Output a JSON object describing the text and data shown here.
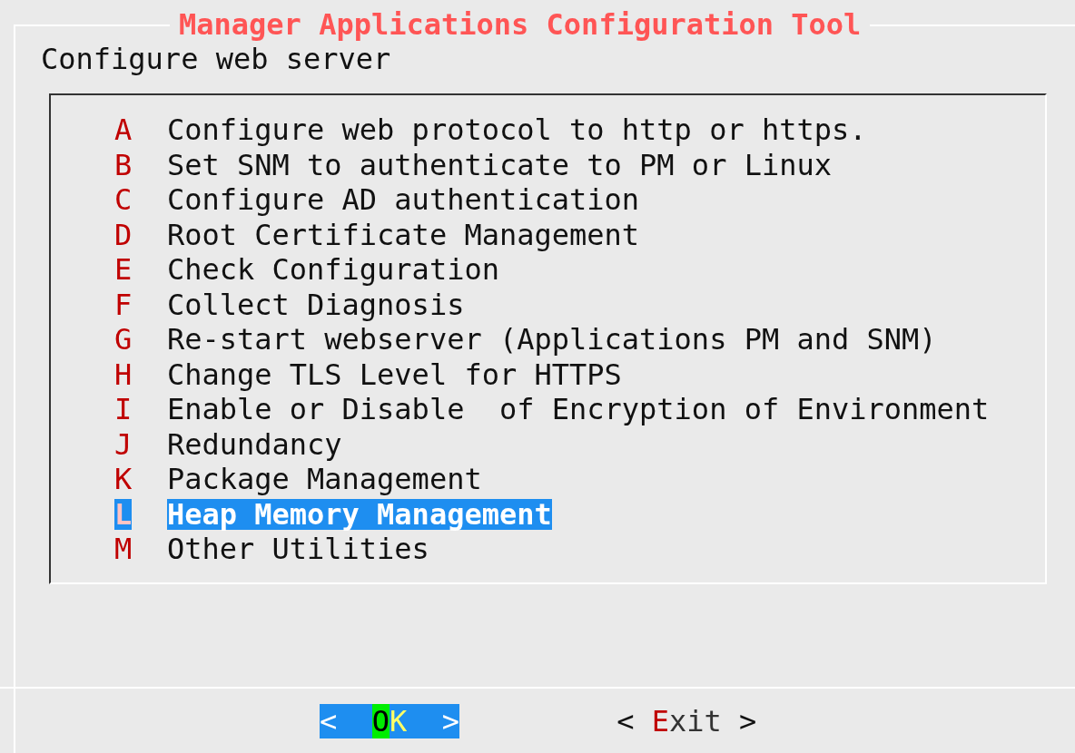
{
  "window": {
    "title": "Manager Applications Configuration Tool"
  },
  "prompt": "Configure web server",
  "menu": {
    "items": [
      {
        "key": "A",
        "label": "Configure web protocol to http or https.",
        "selected": false
      },
      {
        "key": "B",
        "label": "Set SNM to authenticate to PM or Linux",
        "selected": false
      },
      {
        "key": "C",
        "label": "Configure AD authentication",
        "selected": false
      },
      {
        "key": "D",
        "label": "Root Certificate Management",
        "selected": false
      },
      {
        "key": "E",
        "label": "Check Configuration",
        "selected": false
      },
      {
        "key": "F",
        "label": "Collect Diagnosis",
        "selected": false
      },
      {
        "key": "G",
        "label": "Re-start webserver (Applications PM and SNM)",
        "selected": false
      },
      {
        "key": "H",
        "label": "Change TLS Level for HTTPS",
        "selected": false
      },
      {
        "key": "I",
        "label": "Enable or Disable  of Encryption of Environment",
        "selected": false
      },
      {
        "key": "J",
        "label": "Redundancy",
        "selected": false
      },
      {
        "key": "K",
        "label": "Package Management",
        "selected": false
      },
      {
        "key": "L",
        "label": "Heap Memory Management",
        "selected": true
      },
      {
        "key": "M",
        "label": "Other Utilities",
        "selected": false
      }
    ]
  },
  "buttons": [
    {
      "left": "<",
      "label": "OK",
      "right": ">",
      "selected": true
    },
    {
      "left": "<",
      "label": "Exit",
      "right": ">",
      "selected": false
    }
  ]
}
